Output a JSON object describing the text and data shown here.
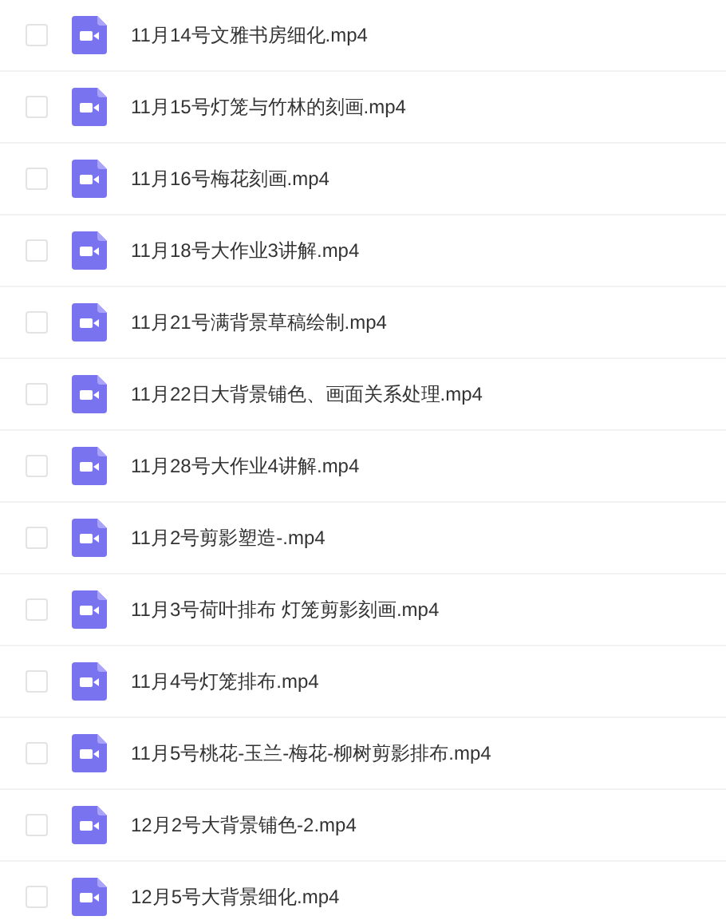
{
  "files": [
    {
      "name": "11月14号文雅书房细化.mp4",
      "checked": false
    },
    {
      "name": "11月15号灯笼与竹林的刻画.mp4",
      "checked": false
    },
    {
      "name": "11月16号梅花刻画.mp4",
      "checked": false
    },
    {
      "name": "11月18号大作业3讲解.mp4",
      "checked": false
    },
    {
      "name": "11月21号满背景草稿绘制.mp4",
      "checked": false
    },
    {
      "name": "11月22日大背景铺色、画面关系处理.mp4",
      "checked": false
    },
    {
      "name": "11月28号大作业4讲解.mp4",
      "checked": false
    },
    {
      "name": "11月2号剪影塑造-.mp4",
      "checked": false
    },
    {
      "name": "11月3号荷叶排布 灯笼剪影刻画.mp4",
      "checked": false
    },
    {
      "name": "11月4号灯笼排布.mp4",
      "checked": false
    },
    {
      "name": "11月5号桃花-玉兰-梅花-柳树剪影排布.mp4",
      "checked": false
    },
    {
      "name": "12月2号大背景铺色-2.mp4",
      "checked": false
    },
    {
      "name": "12月5号大背景细化.mp4",
      "checked": false
    }
  ]
}
